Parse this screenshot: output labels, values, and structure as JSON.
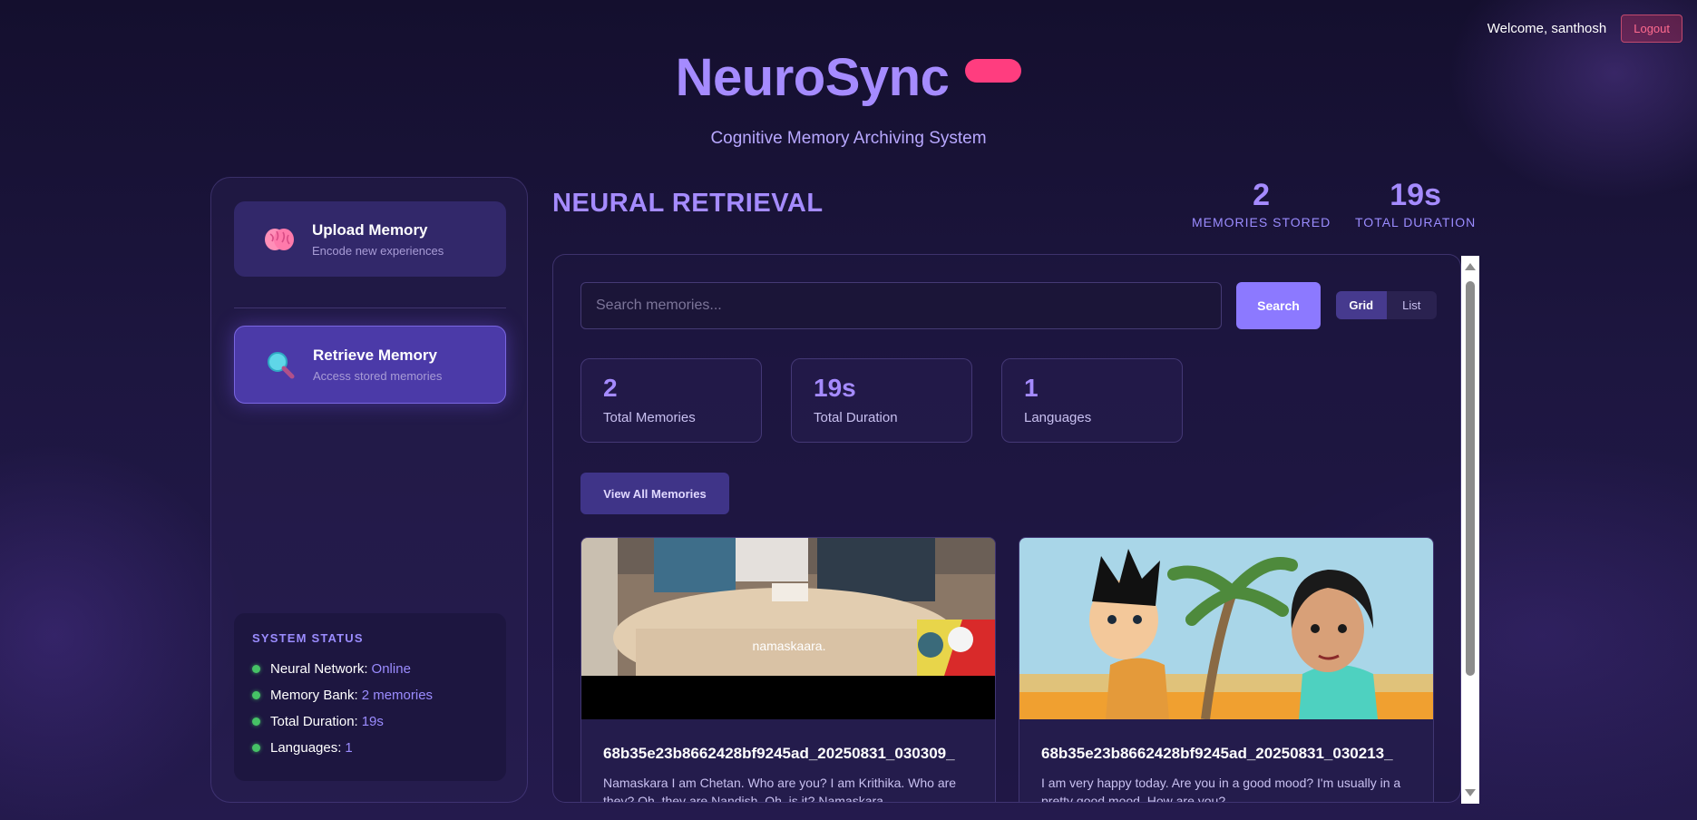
{
  "header": {
    "welcome": "Welcome, santhosh",
    "logout_label": "Logout"
  },
  "brand": {
    "title": "NeuroSync",
    "subtitle": "Cognitive Memory Archiving System"
  },
  "sidebar": {
    "items": [
      {
        "title": "Upload Memory",
        "subtitle": "Encode new experiences",
        "icon": "brain-icon",
        "active": false
      },
      {
        "title": "Retrieve Memory",
        "subtitle": "Access stored memories",
        "icon": "magnifier-icon",
        "active": true
      }
    ],
    "status": {
      "heading": "SYSTEM STATUS",
      "rows": [
        {
          "label": "Neural Network:",
          "value": "Online"
        },
        {
          "label": "Memory Bank:",
          "value": "2 memories"
        },
        {
          "label": "Total Duration:",
          "value": "19s"
        },
        {
          "label": "Languages:",
          "value": "1"
        }
      ]
    }
  },
  "main": {
    "title": "NEURAL RETRIEVAL",
    "metrics": [
      {
        "value": "2",
        "label": "MEMORIES STORED"
      },
      {
        "value": "19s",
        "label": "TOTAL DURATION"
      }
    ],
    "search": {
      "placeholder": "Search memories...",
      "value": "",
      "button_label": "Search"
    },
    "view_toggle": {
      "options": [
        "Grid",
        "List"
      ],
      "selected": "Grid"
    },
    "stats": [
      {
        "value": "2",
        "label": "Total Memories"
      },
      {
        "value": "19s",
        "label": "Total Duration"
      },
      {
        "value": "1",
        "label": "Languages"
      }
    ],
    "view_all_label": "View All Memories",
    "memories": [
      {
        "title": "68b35e23b8662428bf9245ad_20250831_030309_",
        "description": "Namaskara I am Chetan. Who are you? I am Krithika. Who are they? Oh, they are Nandish. Oh, is it? Namaskara",
        "caption": "namaskaara."
      },
      {
        "title": "68b35e23b8662428bf9245ad_20250831_030213_",
        "description": "I am very happy today. Are you in a good mood? I'm usually in a pretty good mood. How are you?"
      }
    ]
  },
  "colors": {
    "accent": "#a58bff",
    "brand_pill": "#ff3d7f",
    "status_ok": "#46c266",
    "logout": "#ff6b8f"
  }
}
